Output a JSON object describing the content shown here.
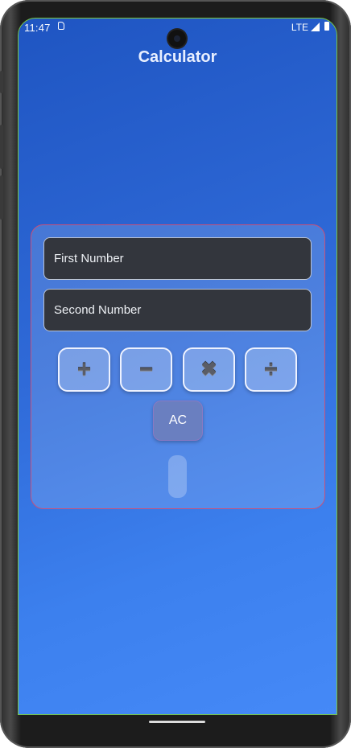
{
  "status_bar": {
    "time": "11:47",
    "network": "LTE",
    "sim_icon": "sim-card-icon",
    "signal_icon": "signal-icon",
    "battery_icon": "battery-icon"
  },
  "app": {
    "title": "Calculator"
  },
  "inputs": {
    "first_placeholder": "First Number",
    "second_placeholder": "Second Number"
  },
  "operations": [
    {
      "symbol": "+",
      "icon": "plus-icon"
    },
    {
      "symbol": "−",
      "icon": "minus-icon"
    },
    {
      "symbol": "✖",
      "icon": "multiply-icon"
    },
    {
      "symbol": "÷",
      "icon": "divide-icon"
    }
  ],
  "clear_button": {
    "label": "AC"
  },
  "result": {
    "value": ""
  },
  "colors": {
    "background_top": "#1f55c2",
    "background_bottom": "#4589f7",
    "card_border": "#c8517a",
    "field_background": "#33363d",
    "ac_button": "#6a7fc0"
  }
}
